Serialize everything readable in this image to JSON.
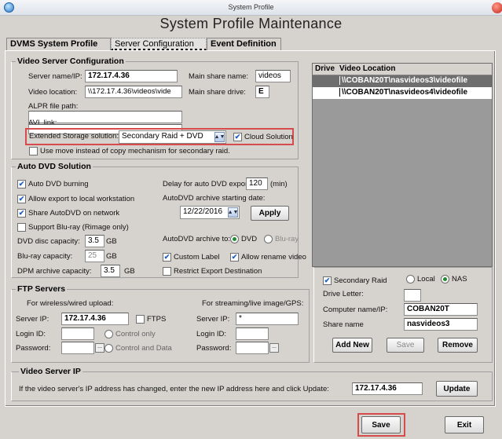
{
  "window": {
    "title": "System Profile"
  },
  "page": {
    "heading": "System Profile Maintenance"
  },
  "tabs": [
    "DVMS System Profile",
    "Server Configuration",
    "Event Definition"
  ],
  "video_server": {
    "group": "Video Server Configuration",
    "server_name_label": "Server name/IP:",
    "server_name": "172.17.4.36",
    "main_share_name_label": "Main share name:",
    "main_share_name": "videos",
    "video_location_label": "Video location:",
    "video_location": "\\\\172.17.4.36\\videos\\vide",
    "main_share_drive_label": "Main share drive:",
    "main_share_drive": "E",
    "alpr_label": "ALPR file path:",
    "alpr_value": "",
    "avl_label": "AVL link:",
    "avl_value": "",
    "ext_storage_label": "Extended Storage solution:",
    "ext_storage_value": "Secondary Raid + DVD",
    "cloud_label": "Cloud Solution",
    "use_move_label": "Use move instead of copy mechanism for secondary raid."
  },
  "drives": {
    "col_drive": "Drive",
    "col_location": "Video Location",
    "rows": [
      {
        "drive": "",
        "location": "\\\\COBAN20T\\nasvideos3\\videofile"
      },
      {
        "drive": "",
        "location": "\\\\COBAN20T\\nasvideos4\\videofile"
      }
    ]
  },
  "auto_dvd": {
    "group": "Auto DVD Solution",
    "auto_burning": "Auto DVD burning",
    "allow_export": "Allow export to local workstation",
    "share_network": "Share AutoDVD on network",
    "support_bluray": "Support Blu-ray (Rimage only)",
    "delay_label": "Delay for auto DVD export:",
    "delay_value": "120",
    "delay_unit": "(min)",
    "start_date_label": "AutoDVD archive starting date:",
    "start_date": "12/22/2016",
    "apply": "Apply",
    "dvd_cap_label": "DVD disc capacity:",
    "dvd_cap": "3.5",
    "gb": "GB",
    "bluray_cap_label": "Blu-ray capacity:",
    "bluray_cap": "25",
    "dpm_cap_label": "DPM archive capacity:",
    "dpm_cap": "3.5",
    "archive_to_label": "AutoDVD archive to:",
    "opt_dvd": "DVD",
    "opt_bluray": "Blu-ray",
    "custom_label": "Custom Label",
    "allow_rename": "Allow rename video",
    "restrict_export": "Restrict Export Destination"
  },
  "ftp": {
    "group": "FTP Servers",
    "left_caption": "For wireless/wired upload:",
    "right_caption": "For streaming/live image/GPS:",
    "server_ip_label": "Server IP:",
    "server_ip": "172.17.4.36",
    "ftps": "FTPS",
    "login_label": "Login ID:",
    "password_label": "Password:",
    "control_only": "Control only",
    "control_data": "Control and Data",
    "right_server_ip": "*",
    "ellipsis": "..."
  },
  "secondary": {
    "secondary_raid": "Secondary Raid",
    "local": "Local",
    "nas": "NAS",
    "drive_letter_label": "Drive Letter:",
    "drive_letter": "",
    "computer_label": "Computer name/IP:",
    "computer": "COBAN20T",
    "share_label": "Share name",
    "share": "nasvideos3",
    "add_new": "Add New",
    "save": "Save",
    "remove": "Remove"
  },
  "video_ip": {
    "group": "Video Server IP",
    "description": "If the video server's IP address has changed, enter the new IP address here and click Update:",
    "value": "172.17.4.36",
    "update": "Update"
  },
  "footer": {
    "save": "Save",
    "exit": "Exit"
  },
  "colors": {
    "highlight": "#d64b4b",
    "selected_row": "#6e6e6e"
  },
  "icons": [
    "app-icon",
    "close-icon",
    "checkmark-icon",
    "dropdown-arrow-icon"
  ]
}
